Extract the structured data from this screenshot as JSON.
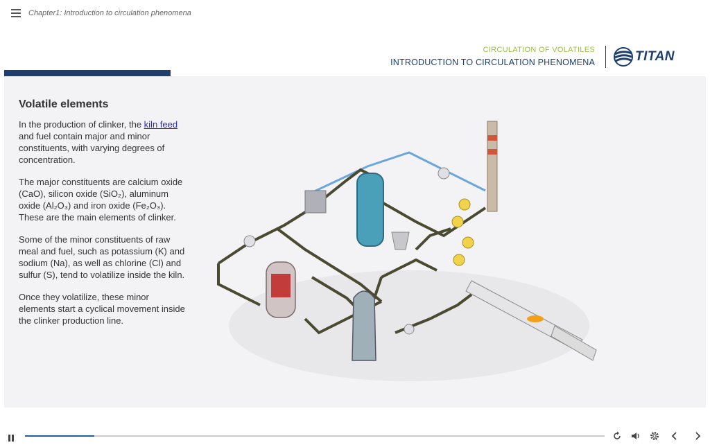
{
  "topbar": {
    "breadcrumb": "Chapter1: Introduction to circulation phenomena"
  },
  "header": {
    "subtitle": "CIRCULATION OF VOLATILES",
    "title": "INTRODUCTION TO CIRCULATION PHENOMENA",
    "logo_text": "TITAN"
  },
  "content": {
    "heading": "Volatile elements",
    "p1_before": "In the production of clinker, the ",
    "p1_link": "kiln feed",
    "p1_after": " and fuel contain major and minor constituents, with varying degrees of concentration.",
    "p2": "The major constituents are calcium oxide (CaO), silicon oxide (SiO₂), aluminum oxide (Al₂O₃) and iron oxide (Fe₂O₃). These are the main elements of clinker.",
    "p3": "Some of the minor constituents of raw meal and fuel, such as potassium (K) and sodium (Na), as well as chlorine (Cl) and sulfur (S), tend to volatilize inside the kiln.",
    "p4": "Once they volatilize, these minor elements start a cyclical movement inside the clinker production line."
  },
  "player": {
    "progress": 0.12
  },
  "colors": {
    "brand": "#1d3e6e",
    "accent": "#9bbd3d",
    "panel": "#f3f2f5"
  },
  "icons": [
    "menu-icon",
    "pause-icon",
    "replay-icon",
    "volume-icon",
    "settings-icon",
    "prev-icon",
    "next-icon"
  ]
}
